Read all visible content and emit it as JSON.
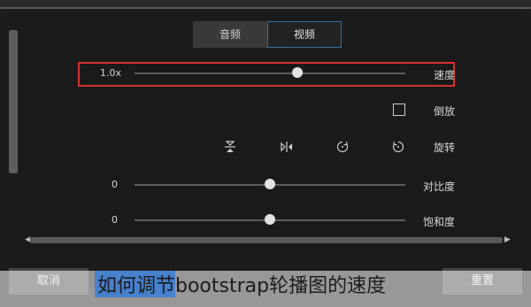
{
  "tabs": [
    {
      "label": "音频",
      "active": false
    },
    {
      "label": "视频",
      "active": true
    }
  ],
  "speed": {
    "label": "速度",
    "value_text": "1.0x",
    "value": 0.6
  },
  "reverse": {
    "label": "倒放",
    "checked": false
  },
  "rotate": {
    "label": "旋转",
    "icons": [
      "rotate-right-icon",
      "rotate-left-icon",
      "flip-horizontal-icon",
      "flip-vertical-icon"
    ]
  },
  "contrast": {
    "label": "对比度",
    "value_text": "0",
    "value": 0.5
  },
  "saturation": {
    "label": "饱和度",
    "value_text": "0",
    "value": 0.5
  },
  "buttons": {
    "cancel": "取消",
    "reset": "重置"
  },
  "caption": "如何调节bootstrap轮播图的速度",
  "colors": {
    "highlight_border": "#d83030",
    "active_tab_border": "#2f6fa8",
    "caption_highlight": "#3a7cd6"
  }
}
